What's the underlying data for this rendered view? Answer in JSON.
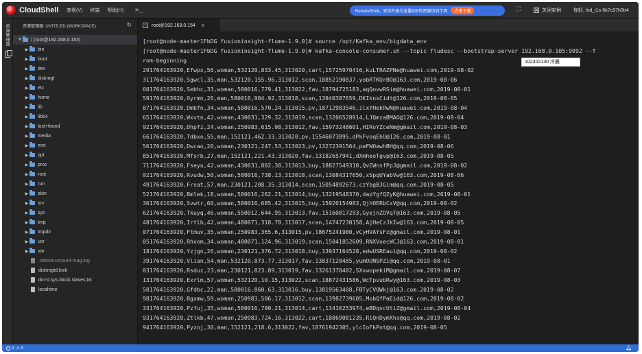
{
  "app": {
    "name": "CloudShell",
    "menu": [
      "查看(V)",
      "终端",
      "帮助(H)"
    ],
    "prompt_icon": "terminal-prompt-icon"
  },
  "promo": {
    "text": "RemoteShell，支持升级为全量IDE的资源访问工具",
    "button": "点击下载"
  },
  "header": {
    "close_instance": "关闭实例",
    "user": "你好, hid_i1s-6k7c97h0tr4"
  },
  "activity": {
    "label": "资源管理器"
  },
  "sidebar": {
    "title": "资源管理器: UNTITLED (WORKSPACE)",
    "root": "/ (root@192.168.0.154)",
    "folders": [
      "bin",
      "boot",
      "dev",
      "diskmgt",
      "etc",
      "home",
      "lib",
      "lib64",
      "lost+found",
      "media",
      "mnt",
      "opt",
      "proc",
      "root",
      "run",
      "sbin",
      "srv",
      "sys",
      "tmp",
      "tmpdir",
      "usr",
      "var"
    ],
    "files": [
      {
        "name": ".reboot-umount-mag.log",
        "muted": true
      },
      {
        "name": "diskmgtd.lock",
        "muted": false
      },
      {
        "name": "dm-0.sys.block.slaves.txt",
        "muted": false
      },
      {
        "name": "localtime",
        "muted": false
      }
    ]
  },
  "tab": {
    "label": "root@192.168.0.154",
    "close": "×"
  },
  "terminal": {
    "lines": [
      "[root@node-master1FbDG fusioninsight-flume-1.9.0]# source /opt/Kafka_env/bigdata_env",
      "[root@node-master1FbDG fusioninsight-flume-1.9.0]# kafka-console-consumer.sh --topic fludesc --bootstrap-server 192.168.0.105:9092 --f",
      "rom-beginning",
      "291764163920,Efwpx,56,woman,532120,833.45,313020,cart,15725970416,kuLTRAZPNe@huawei.com,2019-08-02",
      "311764163920,Sgwcl,35,man,532120,155.96,313012,scan,18852190837,yobRTKUrBO@163.com,2019-08-06",
      "601764163920,Sebhc,33,woman,580016,779.41,313022,fav,18794725183,aqQovwRSim@huawei.com,2019-08-01",
      "591764163920,Oyrmn,26,man,580016,904.92,313018,scan,13940387659,DKIknsCidt@126.com,2019-08-05",
      "871764163920,Dmbfn,34,woman,580016,570.24,313015,pv,18712983546,ilxYHekRwN@huawei.com,2019-08-04",
      "651764163920,Wxvtn,42,woman,430031,329.32,313019,scan,13206528914,LJQmzaBMAO@126.com,2019-08-04",
      "921764163920,Dhpfz,24,woman,250983,615.98,313012,fav,15973248601,HIRoYZceNm@gmail.com,2019-08-03",
      "661764163920,Tdbxo,55,man,152121,462.33,313020,pv,15546073895,dPkFvoqEhU@126.com,2019-08-01",
      "561764163920,Dwcao,20,woman,230121,247.53,313023,pv,13272391564,peFWOawhBH@qq.com,2019-08-06",
      "851764163920,Mfsrb,27,man,152121,221.43,313020,fav,13182657941,dXmheoTgvp@163.com,2019-08-05",
      "711764163920,Fseyu,42,woman,430031,802.38,313013,buy,18827549318,QvEWnsfPpJ@gmail.com,2019-08-02",
      "021764163920,Rvudw,50,woman,580016,738.13,313018,scan,13084317650,xSpqUYabVw@163.com,2019-08-06",
      "491764163920,Frsat,57,man,230121,208.35,313014,scan,15054892673,czYbgBJGim@qq.com,2019-08-05",
      "521764163920,Bmlek,18,woman,580016,262.21,313014,buy,13219548370,dapYgfQZyK@huawei.com,2019-08-01",
      "361764163920,Svwtr,60,woman,580016,685.42,313015,buy,15920154983,QjhOERbCxV@qq.com,2019-08-02",
      "621764163920,Tkuyq,46,woman,550012,644.95,313013,fav,15160817293,GyejnZOVqT@163.com,2019-08-05",
      "481764163920,Irtlb,42,woman,480071,318.78,313017,scan,14747230158,AjHeCzJkIw@163.com,2019-08-05",
      "071764163920,Ftmuv,35,woman,250983,365.6,313015,pv,18675241980,vCyHVAYsFz@gmail.com,2019-08-01",
      "051764163920,Rhvom,34,woman,480071,124.96,313019,scan,15041852609,RNXVoecWCJ@163.com,2019-08-01",
      "181764163920,Yzjgn,26,woman,230121,376.72,313018,buy,13937164528,edwUSREaui@qq.com,2019-08-02",
      "391764163920,Vlian,54,man,532120,873.77,313017,fav,13837120485,yumOUNSPZi@qq.com,2019-08-01",
      "031764163920,Rsduz,23,man,230121,823.89,313019,fav,13261378402,SXxwopekiM@gmail.com,2019-08-07",
      "131764163920,Exrlm,57,woman,532120,10.15,313022,scan,18872431586,WcTpvubRwy@163.com,2019-08-03",
      "501764163920,Gfdbc,22,man,580016,860.63,313016,buy,13819563408,FBTyCVQWkj@163.com,2019-08-02",
      "981764163920,Bgxmw,59,woman,250983,506.17,313012,scan,13982739605,MobQfPaEid@126.com,2019-08-02",
      "331764163920,Pzfuj,35,woman,580016,790.21,313014,cart,13416253974,eBDqvcUtiZ@gmail.com,2019-08-04",
      "931764163920,Ztlkb,47,woman,250983,724.16,313022,cart,18869081235,RiQnDymXhs@qq.com,2019-08-02",
      "941764163920,Pyzoj,30,man,152121,218.6,313022,fav,18761942305,ylcIoFkPnt@qq.com,2019-08-05"
    ]
  },
  "tooltip": {
    "text": "102302130 冷晨"
  },
  "statusbar": {
    "errors": "0",
    "warnings": "0"
  },
  "colors": {
    "accent": "#2f6ed6",
    "promo": "#3b6fe0",
    "promo_button": "#ff6a2a",
    "terminal_bg": "#1e1e1e",
    "folder": "#6a9fd8"
  }
}
